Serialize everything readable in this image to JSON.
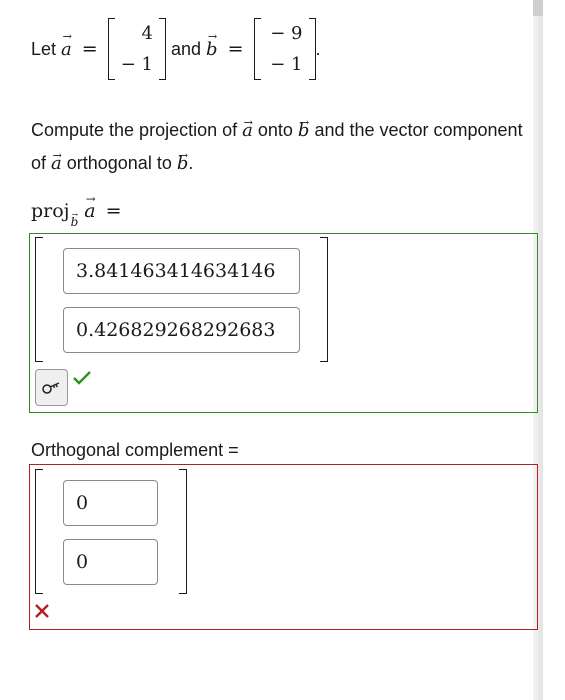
{
  "colors": {
    "correct": "#2f8f1f",
    "incorrect": "#b32020"
  },
  "problem": {
    "let_word": "Let",
    "and_word": "and",
    "period": ".",
    "equals": "=",
    "vector_a_name": "a",
    "vector_b_name": "b",
    "vector_a": [
      "4",
      "− 1"
    ],
    "vector_b": [
      "− 9",
      "− 1"
    ],
    "instruction": {
      "part1": "Compute the projection of ",
      "a": "a",
      "part2": " onto ",
      "b": "b",
      "part3": " and the vector component of ",
      "a2": "a",
      "part4": " orthogonal to ",
      "b2": "b",
      "part5": "."
    }
  },
  "projection": {
    "label": "proj",
    "sub": "b",
    "vector": "a",
    "equals": "=",
    "values": [
      "3.841463414634146",
      "0.426829268292683"
    ],
    "status": "correct",
    "key_icon": "key-icon",
    "status_icon": "check-icon"
  },
  "orthogonal": {
    "label": "Orthogonal complement =",
    "values": [
      "0",
      "0"
    ],
    "status": "incorrect",
    "status_icon": "cross-icon"
  }
}
